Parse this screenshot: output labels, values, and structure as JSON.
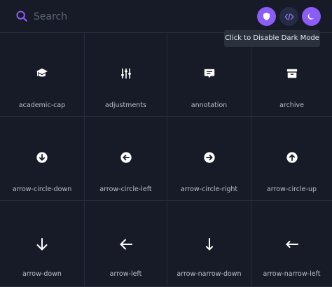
{
  "search": {
    "placeholder": "Search"
  },
  "header": {
    "buttons": [
      {
        "icon": "shield-icon"
      },
      {
        "icon": "code-icon"
      },
      {
        "icon": "moon-icon"
      }
    ],
    "tooltip": "Click to Disable Dark Mode"
  },
  "colors": {
    "accent": "#8b5cf6",
    "background": "#141925",
    "cell": "#161b27",
    "border": "#262d3a",
    "label": "#b8bfcb"
  },
  "icons": [
    {
      "label": "academic-cap",
      "icon": "academic-cap-icon"
    },
    {
      "label": "adjustments",
      "icon": "adjustments-icon"
    },
    {
      "label": "annotation",
      "icon": "annotation-icon"
    },
    {
      "label": "archive",
      "icon": "archive-icon"
    },
    {
      "label": "arrow-circle-down",
      "icon": "arrow-circle-down-icon"
    },
    {
      "label": "arrow-circle-left",
      "icon": "arrow-circle-left-icon"
    },
    {
      "label": "arrow-circle-right",
      "icon": "arrow-circle-right-icon"
    },
    {
      "label": "arrow-circle-up",
      "icon": "arrow-circle-up-icon"
    },
    {
      "label": "arrow-down",
      "icon": "arrow-down-icon"
    },
    {
      "label": "arrow-left",
      "icon": "arrow-left-icon"
    },
    {
      "label": "arrow-narrow-down",
      "icon": "arrow-narrow-down-icon"
    },
    {
      "label": "arrow-narrow-left",
      "icon": "arrow-narrow-left-icon"
    }
  ]
}
